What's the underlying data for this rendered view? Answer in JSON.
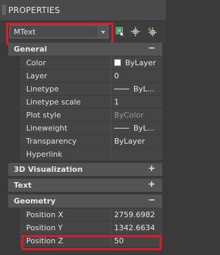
{
  "window": {
    "title": "PROPERTIES"
  },
  "toolbar": {
    "object_type": "MText",
    "icons": [
      "quick-select-icon",
      "select-objects-icon",
      "toggle-pickadd-icon"
    ]
  },
  "sections": {
    "general": {
      "label": "General",
      "toggle": "−",
      "rows": [
        {
          "name": "Color",
          "value": "ByLayer"
        },
        {
          "name": "Layer",
          "value": "0"
        },
        {
          "name": "Linetype",
          "value": "ByL..."
        },
        {
          "name": "Linetype scale",
          "value": "1"
        },
        {
          "name": "Plot style",
          "value": "ByColor"
        },
        {
          "name": "Lineweight",
          "value": "ByL..."
        },
        {
          "name": "Transparency",
          "value": "ByLayer"
        },
        {
          "name": "Hyperlink",
          "value": ""
        }
      ]
    },
    "visualization3d": {
      "label": "3D Visualization",
      "toggle": "+"
    },
    "text": {
      "label": "Text",
      "toggle": "+"
    },
    "geometry": {
      "label": "Geometry",
      "toggle": "−",
      "rows": [
        {
          "name": "Position X",
          "value": "2759.6982"
        },
        {
          "name": "Position Y",
          "value": "1342.6634"
        },
        {
          "name": "Position Z",
          "value": "50"
        }
      ]
    }
  },
  "colors": {
    "highlight": "#e01a24",
    "panel": "#454545",
    "header": "#545454"
  }
}
